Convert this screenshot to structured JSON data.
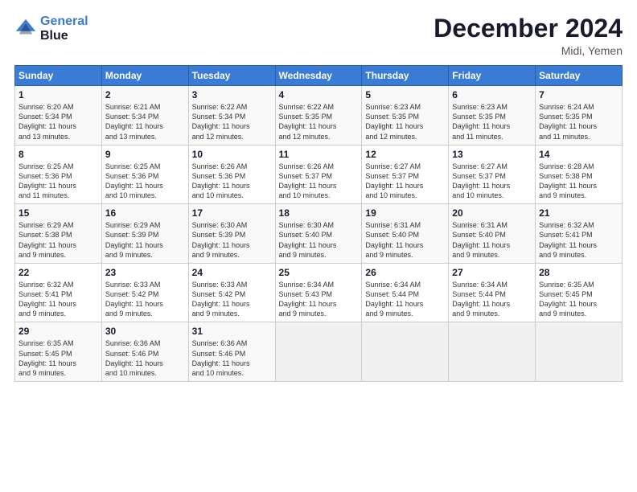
{
  "header": {
    "logo_line1": "General",
    "logo_line2": "Blue",
    "title": "December 2024",
    "subtitle": "Midi, Yemen"
  },
  "days_of_week": [
    "Sunday",
    "Monday",
    "Tuesday",
    "Wednesday",
    "Thursday",
    "Friday",
    "Saturday"
  ],
  "weeks": [
    [
      {
        "day": "1",
        "detail": "Sunrise: 6:20 AM\nSunset: 5:34 PM\nDaylight: 11 hours\nand 13 minutes."
      },
      {
        "day": "2",
        "detail": "Sunrise: 6:21 AM\nSunset: 5:34 PM\nDaylight: 11 hours\nand 13 minutes."
      },
      {
        "day": "3",
        "detail": "Sunrise: 6:22 AM\nSunset: 5:34 PM\nDaylight: 11 hours\nand 12 minutes."
      },
      {
        "day": "4",
        "detail": "Sunrise: 6:22 AM\nSunset: 5:35 PM\nDaylight: 11 hours\nand 12 minutes."
      },
      {
        "day": "5",
        "detail": "Sunrise: 6:23 AM\nSunset: 5:35 PM\nDaylight: 11 hours\nand 12 minutes."
      },
      {
        "day": "6",
        "detail": "Sunrise: 6:23 AM\nSunset: 5:35 PM\nDaylight: 11 hours\nand 11 minutes."
      },
      {
        "day": "7",
        "detail": "Sunrise: 6:24 AM\nSunset: 5:35 PM\nDaylight: 11 hours\nand 11 minutes."
      }
    ],
    [
      {
        "day": "8",
        "detail": "Sunrise: 6:25 AM\nSunset: 5:36 PM\nDaylight: 11 hours\nand 11 minutes."
      },
      {
        "day": "9",
        "detail": "Sunrise: 6:25 AM\nSunset: 5:36 PM\nDaylight: 11 hours\nand 10 minutes."
      },
      {
        "day": "10",
        "detail": "Sunrise: 6:26 AM\nSunset: 5:36 PM\nDaylight: 11 hours\nand 10 minutes."
      },
      {
        "day": "11",
        "detail": "Sunrise: 6:26 AM\nSunset: 5:37 PM\nDaylight: 11 hours\nand 10 minutes."
      },
      {
        "day": "12",
        "detail": "Sunrise: 6:27 AM\nSunset: 5:37 PM\nDaylight: 11 hours\nand 10 minutes."
      },
      {
        "day": "13",
        "detail": "Sunrise: 6:27 AM\nSunset: 5:37 PM\nDaylight: 11 hours\nand 10 minutes."
      },
      {
        "day": "14",
        "detail": "Sunrise: 6:28 AM\nSunset: 5:38 PM\nDaylight: 11 hours\nand 9 minutes."
      }
    ],
    [
      {
        "day": "15",
        "detail": "Sunrise: 6:29 AM\nSunset: 5:38 PM\nDaylight: 11 hours\nand 9 minutes."
      },
      {
        "day": "16",
        "detail": "Sunrise: 6:29 AM\nSunset: 5:39 PM\nDaylight: 11 hours\nand 9 minutes."
      },
      {
        "day": "17",
        "detail": "Sunrise: 6:30 AM\nSunset: 5:39 PM\nDaylight: 11 hours\nand 9 minutes."
      },
      {
        "day": "18",
        "detail": "Sunrise: 6:30 AM\nSunset: 5:40 PM\nDaylight: 11 hours\nand 9 minutes."
      },
      {
        "day": "19",
        "detail": "Sunrise: 6:31 AM\nSunset: 5:40 PM\nDaylight: 11 hours\nand 9 minutes."
      },
      {
        "day": "20",
        "detail": "Sunrise: 6:31 AM\nSunset: 5:40 PM\nDaylight: 11 hours\nand 9 minutes."
      },
      {
        "day": "21",
        "detail": "Sunrise: 6:32 AM\nSunset: 5:41 PM\nDaylight: 11 hours\nand 9 minutes."
      }
    ],
    [
      {
        "day": "22",
        "detail": "Sunrise: 6:32 AM\nSunset: 5:41 PM\nDaylight: 11 hours\nand 9 minutes."
      },
      {
        "day": "23",
        "detail": "Sunrise: 6:33 AM\nSunset: 5:42 PM\nDaylight: 11 hours\nand 9 minutes."
      },
      {
        "day": "24",
        "detail": "Sunrise: 6:33 AM\nSunset: 5:42 PM\nDaylight: 11 hours\nand 9 minutes."
      },
      {
        "day": "25",
        "detail": "Sunrise: 6:34 AM\nSunset: 5:43 PM\nDaylight: 11 hours\nand 9 minutes."
      },
      {
        "day": "26",
        "detail": "Sunrise: 6:34 AM\nSunset: 5:44 PM\nDaylight: 11 hours\nand 9 minutes."
      },
      {
        "day": "27",
        "detail": "Sunrise: 6:34 AM\nSunset: 5:44 PM\nDaylight: 11 hours\nand 9 minutes."
      },
      {
        "day": "28",
        "detail": "Sunrise: 6:35 AM\nSunset: 5:45 PM\nDaylight: 11 hours\nand 9 minutes."
      }
    ],
    [
      {
        "day": "29",
        "detail": "Sunrise: 6:35 AM\nSunset: 5:45 PM\nDaylight: 11 hours\nand 9 minutes."
      },
      {
        "day": "30",
        "detail": "Sunrise: 6:36 AM\nSunset: 5:46 PM\nDaylight: 11 hours\nand 10 minutes."
      },
      {
        "day": "31",
        "detail": "Sunrise: 6:36 AM\nSunset: 5:46 PM\nDaylight: 11 hours\nand 10 minutes."
      },
      null,
      null,
      null,
      null
    ]
  ]
}
